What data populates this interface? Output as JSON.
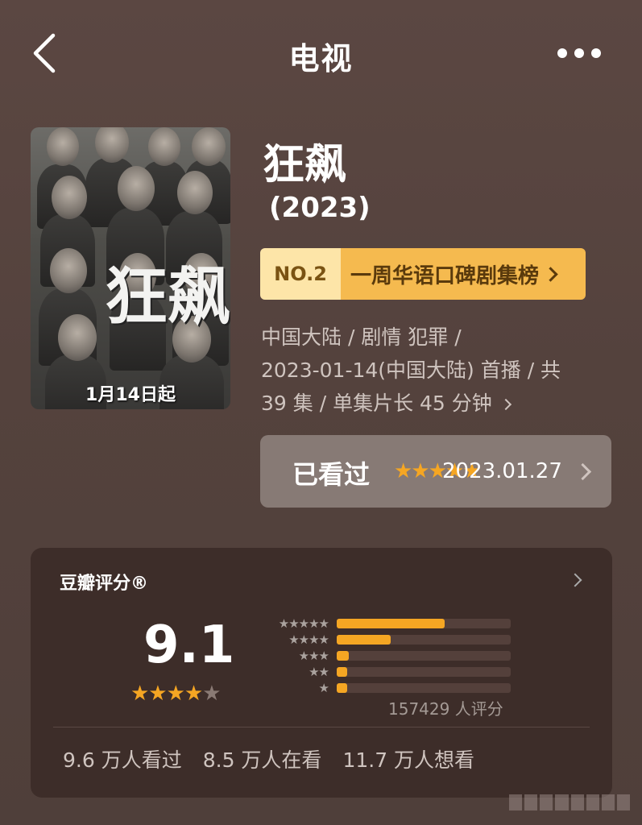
{
  "header": {
    "title": "电视",
    "back_icon": "chevron-left-icon",
    "more_icon": "more-horizontal-icon"
  },
  "show": {
    "title": "狂飙",
    "year": "(2023)",
    "poster_title": "狂飙",
    "poster_date": "1月14日起",
    "rank": {
      "no": "NO.2",
      "name": "一周华语口碑剧集榜"
    },
    "meta": {
      "line1": "中国大陆 / 剧情 犯罪 /",
      "line2": "2023-01-14(中国大陆) 首播 / 共",
      "line3": "39 集 / 单集片长 45 分钟"
    },
    "watched": {
      "label": "已看过",
      "stars": "★★★★★",
      "date": "2023.01.27"
    }
  },
  "rating": {
    "header": "豆瓣评分®",
    "score": "9.1",
    "stars_full": "★★★★",
    "stars_half": "★",
    "distribution": [
      {
        "stars": "★★★★★",
        "fraction": 0.62
      },
      {
        "stars": "★★★★",
        "fraction": 0.31
      },
      {
        "stars": "★★★",
        "fraction": 0.07
      },
      {
        "stars": "★★",
        "fraction": 0.06
      },
      {
        "stars": "★",
        "fraction": 0.06
      }
    ],
    "count": "157429 人评分",
    "stats": {
      "watched": "9.6 万人看过",
      "watching": "8.5 万人在看",
      "want": "11.7 万人想看"
    }
  },
  "colors": {
    "accent": "#f5a623",
    "badge_left": "#fde5a8",
    "badge_right": "#f5ba4f",
    "background": "#54423d"
  }
}
